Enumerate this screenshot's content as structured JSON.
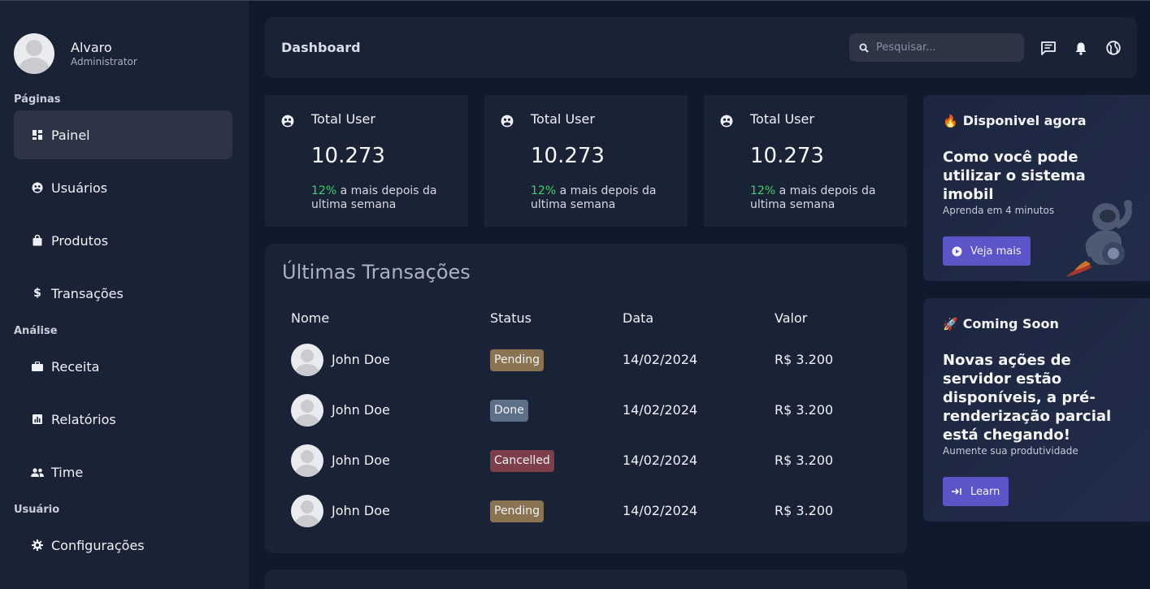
{
  "user": {
    "name": "Alvaro",
    "role": "Administrator"
  },
  "sidebar": {
    "sections": [
      "Páginas",
      "Análise",
      "Usuário"
    ],
    "items": [
      {
        "label": "Painel",
        "icon": "dashboard-icon"
      },
      {
        "label": "Usuários",
        "icon": "users-icon"
      },
      {
        "label": "Produtos",
        "icon": "bag-icon"
      },
      {
        "label": "Transações",
        "icon": "dollar-icon"
      },
      {
        "label": "Receita",
        "icon": "briefcase-icon"
      },
      {
        "label": "Relatórios",
        "icon": "chart-icon"
      },
      {
        "label": "Time",
        "icon": "team-icon"
      },
      {
        "label": "Configurações",
        "icon": "gear-icon"
      }
    ]
  },
  "header": {
    "title": "Dashboard",
    "search_placeholder": "Pesquisar..."
  },
  "stats": [
    {
      "title": "Total User",
      "value": "10.273",
      "pct": "12%",
      "note": " a mais depois da ultima semana"
    },
    {
      "title": "Total User",
      "value": "10.273",
      "pct": "12%",
      "note": " a mais depois da ultima semana"
    },
    {
      "title": "Total User",
      "value": "10.273",
      "pct": "12%",
      "note": " a mais depois da ultima semana"
    }
  ],
  "transactions": {
    "title": "Últimas Transações",
    "columns": [
      "Nome",
      "Status",
      "Data",
      "Valor"
    ],
    "rows": [
      {
        "name": "John Doe",
        "status": "Pending",
        "date": "14/02/2024",
        "value": "R$ 3.200"
      },
      {
        "name": "John Doe",
        "status": "Done",
        "date": "14/02/2024",
        "value": "R$ 3.200"
      },
      {
        "name": "John Doe",
        "status": "Cancelled",
        "date": "14/02/2024",
        "value": "R$ 3.200"
      },
      {
        "name": "John Doe",
        "status": "Pending",
        "date": "14/02/2024",
        "value": "R$ 3.200"
      }
    ]
  },
  "promos": [
    {
      "emoji": "🔥",
      "head": "Disponivel agora",
      "title": "Como você pode utilizar o sistema imobil",
      "sub": "Aprenda em 4 minutos",
      "button": "Veja mais"
    },
    {
      "emoji": "🚀",
      "head": "Coming Soon",
      "title": "Novas ações de servidor estão disponíveis, a pré-renderização parcial está chegando!",
      "sub": "Aumente sua produtividade",
      "button": "Learn"
    }
  ],
  "colors": {
    "accent": "#5b55c9",
    "positive": "#38d16a",
    "pending": "#8a7351",
    "done": "#5e7087",
    "cancelled": "#7e3e4a"
  }
}
